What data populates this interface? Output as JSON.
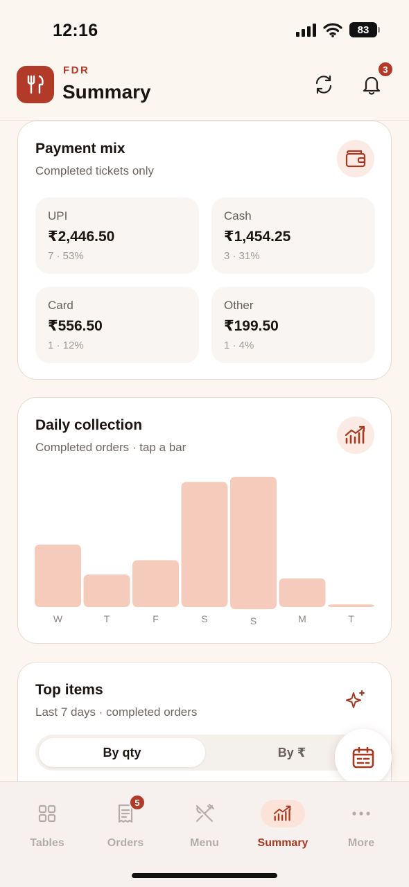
{
  "status_bar": {
    "time": "12:16",
    "battery": "83"
  },
  "header": {
    "brand": "FDR",
    "title": "Summary",
    "notifications_count": "3"
  },
  "payment_mix": {
    "title": "Payment mix",
    "subtitle": "Completed tickets only",
    "methods": [
      {
        "label": "UPI",
        "amount": "₹2,446.50",
        "meta": "7 · 53%"
      },
      {
        "label": "Cash",
        "amount": "₹1,454.25",
        "meta": "3 · 31%"
      },
      {
        "label": "Card",
        "amount": "₹556.50",
        "meta": "1 · 12%"
      },
      {
        "label": "Other",
        "amount": "₹199.50",
        "meta": "1 · 4%"
      }
    ]
  },
  "daily_collection": {
    "title": "Daily collection",
    "subtitle": "Completed orders · tap a bar",
    "chart_data": {
      "type": "bar",
      "categories": [
        "W",
        "T",
        "F",
        "S",
        "S",
        "M",
        "T"
      ],
      "values": [
        0.48,
        0.25,
        0.36,
        0.96,
        1.0,
        0.22,
        0.02
      ],
      "ylim": [
        0,
        1
      ],
      "grid": false,
      "bar_color": "#f5cbbb",
      "highlight_index": 4
    }
  },
  "top_items": {
    "title": "Top items",
    "subtitle": "Last 7 days · completed orders",
    "tabs": [
      {
        "label": "By qty"
      },
      {
        "label": "By ₹"
      }
    ]
  },
  "bottom_nav": {
    "items": [
      {
        "label": "Tables"
      },
      {
        "label": "Orders",
        "badge": "5"
      },
      {
        "label": "Menu"
      },
      {
        "label": "Summary"
      },
      {
        "label": "More"
      }
    ],
    "active_index": 3
  },
  "colors": {
    "accent": "#b23a28",
    "background": "#fcf6f1",
    "bar": "#f5cbbb"
  }
}
